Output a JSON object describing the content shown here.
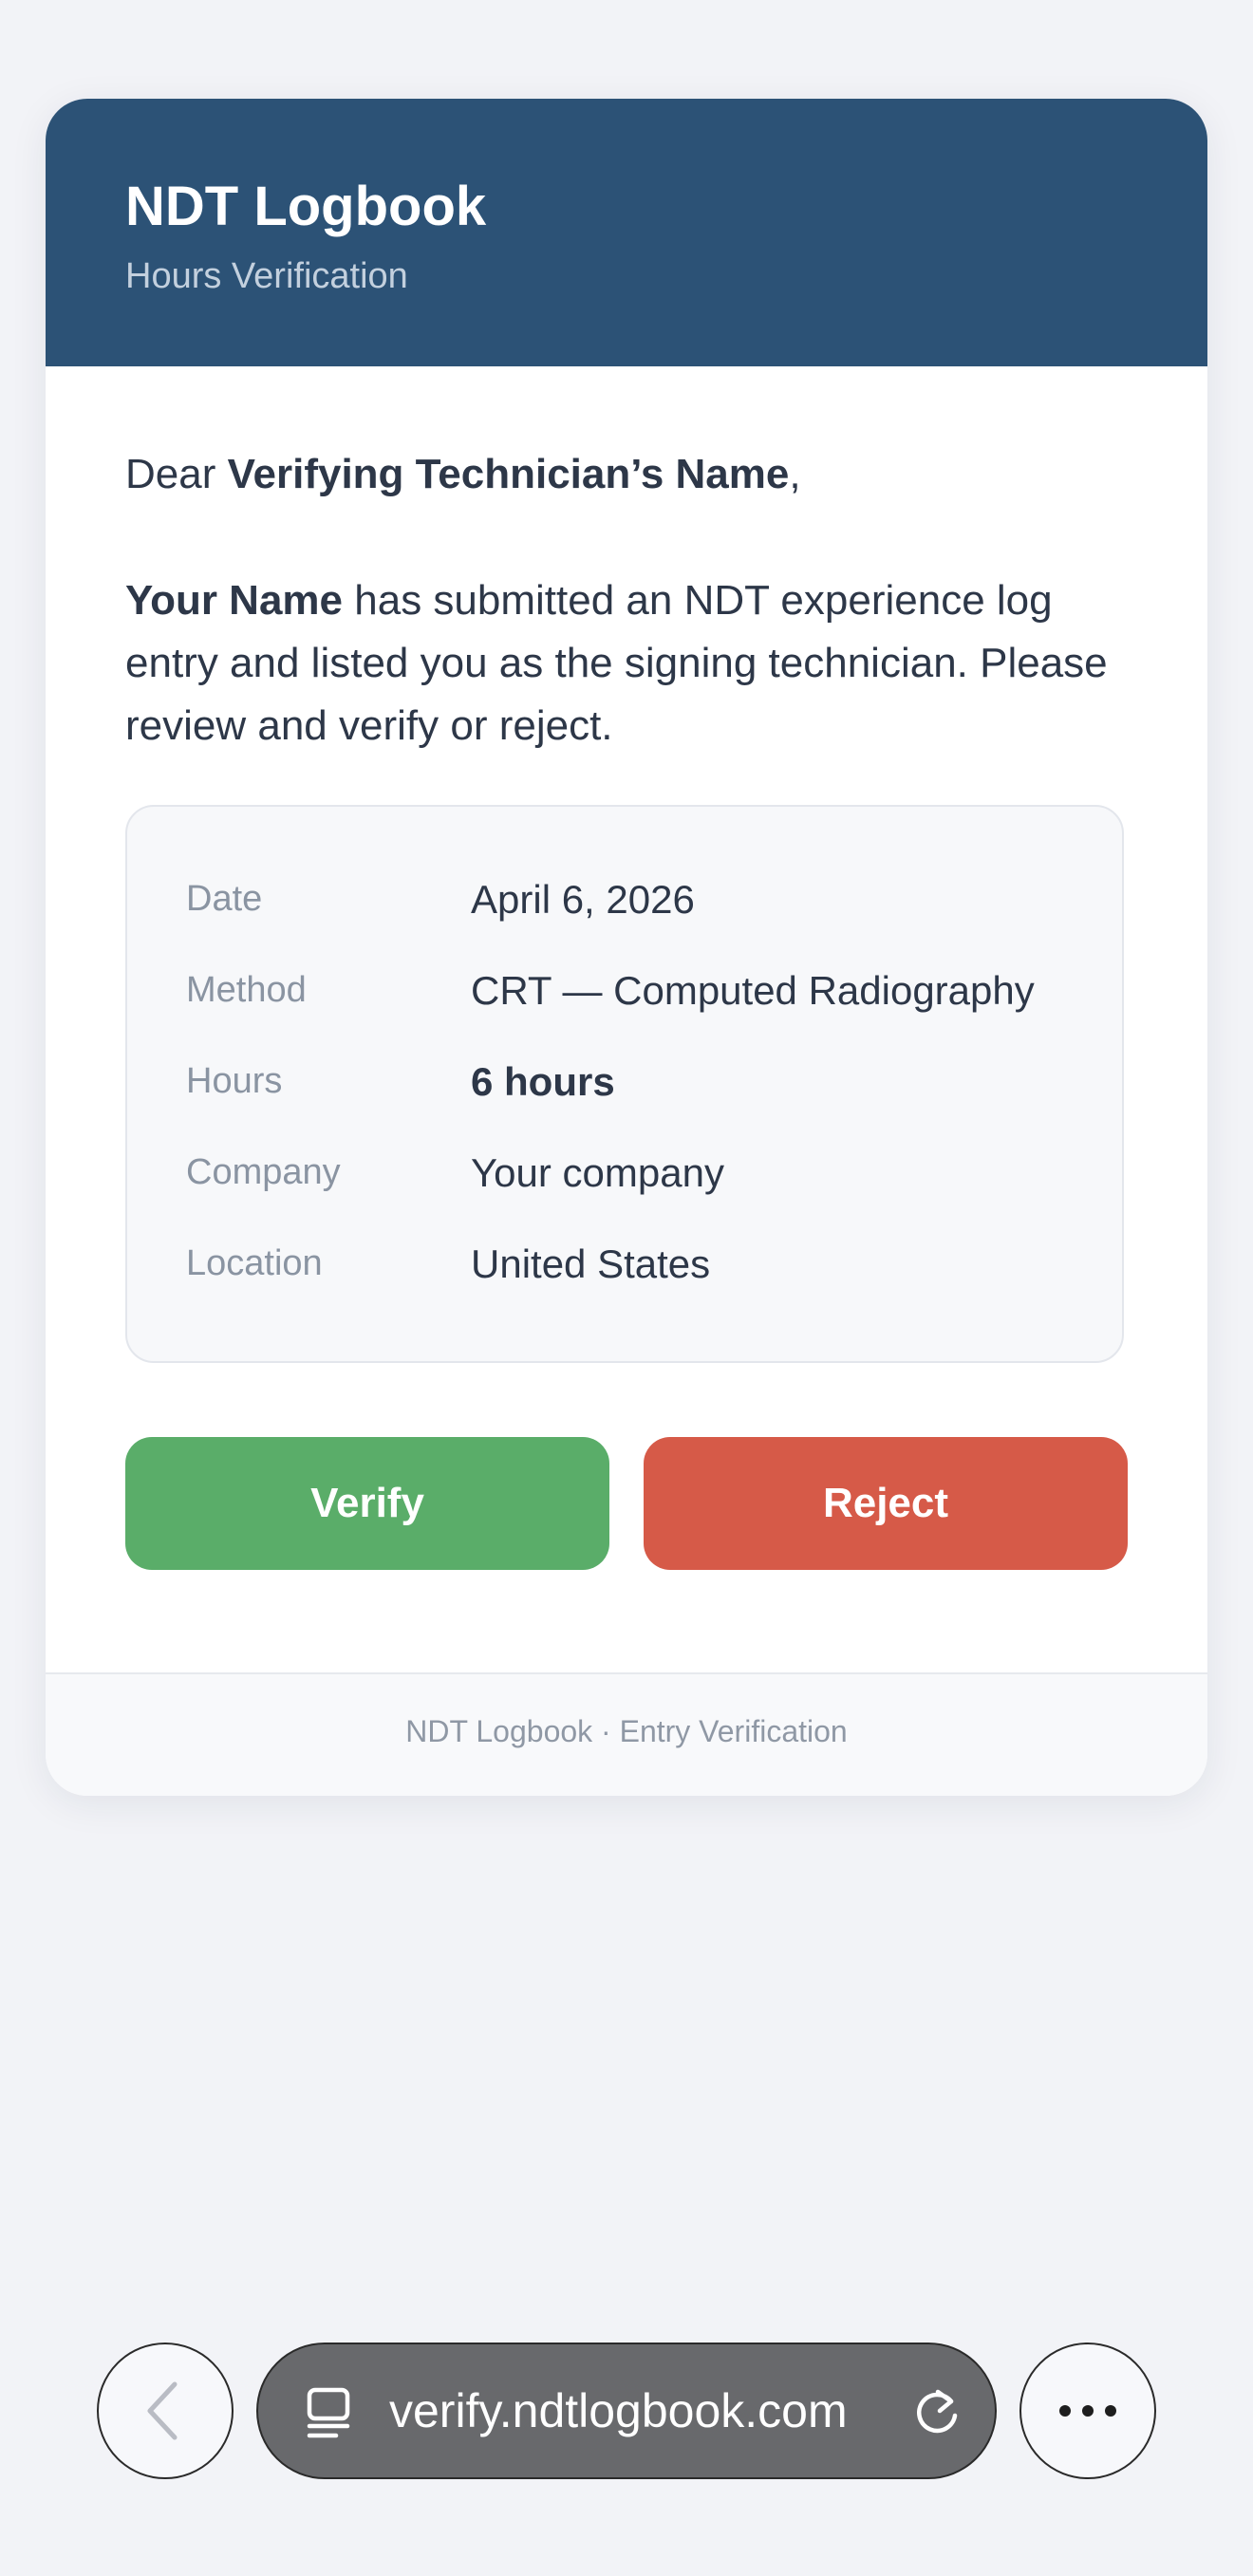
{
  "header": {
    "title": "NDT Logbook",
    "subtitle": "Hours Verification"
  },
  "greeting": {
    "prefix": "Dear ",
    "name": "Verifying Technician’s Name",
    "suffix": ","
  },
  "message": {
    "submitter": "Your Name",
    "body": " has submitted an NDT experience log entry and listed you as the signing technician. Please review and verify or reject."
  },
  "details": [
    {
      "label": "Date",
      "value": "April 6, 2026"
    },
    {
      "label": "Method",
      "value": "CRT — Computed Radiography"
    },
    {
      "label": "Hours",
      "value": "6 hours"
    },
    {
      "label": "Company",
      "value": "Your company"
    },
    {
      "label": "Location",
      "value": "United States"
    }
  ],
  "actions": {
    "verify_label": "Verify",
    "reject_label": "Reject"
  },
  "footer": {
    "text": "NDT Logbook · Entry Verification"
  },
  "browser": {
    "url": "verify.ndtlogbook.com",
    "icons": [
      "back-icon",
      "tabs-icon",
      "reload-icon",
      "more-icon"
    ]
  },
  "colors": {
    "header_bg": "#2c5276",
    "verify": "#5aad69",
    "reject": "#d65a48",
    "page_bg": "#f2f3f7"
  }
}
